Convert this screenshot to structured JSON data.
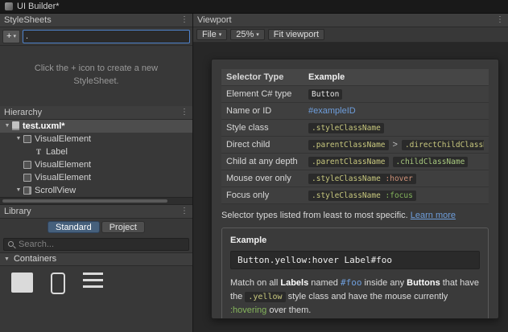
{
  "window": {
    "title": "UI Builder*"
  },
  "icons": {
    "kebab": "⋮",
    "dropdown": "▾",
    "fold_open": "▼"
  },
  "colors": {
    "plain": "#E6E6E6",
    "id": "#6E9EDC",
    "class": "#C8C87E",
    "class2": "#A8C97F",
    "hover": "#CE9178",
    "focus": "#85B55C",
    "sep": "#BFBFBF",
    "link": "#6E9EDC",
    "tab_active": "#46607C",
    "selection": "#4D4D4D",
    "focus_border": "#4F83CC"
  },
  "stylesheets": {
    "title": "StyleSheets",
    "add_label": "+",
    "selector_input_value": ".",
    "empty_message": "Click the + icon to create a new StyleSheet."
  },
  "hierarchy": {
    "title": "Hierarchy",
    "items": [
      {
        "label": "test.uxml*",
        "depth": 0,
        "arrow": "▼",
        "icon": "uxml-document",
        "selected": true
      },
      {
        "label": "VisualElement",
        "depth": 1,
        "arrow": "▼",
        "icon": "visual-element",
        "selected": false
      },
      {
        "label": "Label",
        "depth": 2,
        "arrow": "",
        "icon": "label",
        "selected": false
      },
      {
        "label": "VisualElement",
        "depth": 1,
        "arrow": "",
        "icon": "visual-element",
        "selected": false
      },
      {
        "label": "VisualElement",
        "depth": 1,
        "arrow": "",
        "icon": "visual-element",
        "selected": false
      },
      {
        "label": "ScrollView",
        "depth": 1,
        "arrow": "▼",
        "icon": "scroll-view",
        "selected": false
      }
    ]
  },
  "library": {
    "title": "Library",
    "tabs": [
      {
        "label": "Standard",
        "active": true
      },
      {
        "label": "Project",
        "active": false
      }
    ],
    "search_placeholder": "Search...",
    "containers_section": "Containers",
    "items": [
      {
        "name": "visual-element"
      },
      {
        "name": "scroll-view"
      },
      {
        "name": "list-view"
      }
    ]
  },
  "viewport": {
    "title": "Viewport",
    "toolbar": {
      "file_label": "File",
      "zoom_value": "25%",
      "fit_label": "Fit viewport"
    },
    "selector_table": {
      "headers": [
        "Selector Type",
        "Example"
      ],
      "rows": [
        {
          "label": "Element C# type",
          "example": [
            {
              "chip": true,
              "tokens": [
                {
                  "text": "Button",
                  "color": "plain"
                }
              ]
            }
          ]
        },
        {
          "label": "Name or ID",
          "example": [
            {
              "chip": false,
              "tokens": [
                {
                  "text": "#exampleID",
                  "color": "id"
                }
              ]
            }
          ]
        },
        {
          "label": "Style class",
          "example": [
            {
              "chip": true,
              "tokens": [
                {
                  "text": ".styleClassName",
                  "color": "class"
                }
              ]
            }
          ]
        },
        {
          "label": "Direct child",
          "example": [
            {
              "chip": true,
              "tokens": [
                {
                  "text": ".parentClassName",
                  "color": "class"
                }
              ]
            },
            {
              "chip": false,
              "tokens": [
                {
                  "text": ">",
                  "color": "sep"
                }
              ]
            },
            {
              "chip": true,
              "tokens": [
                {
                  "text": ".directChildClassName",
                  "color": "class"
                }
              ]
            }
          ]
        },
        {
          "label": "Child at any depth",
          "example": [
            {
              "chip": true,
              "tokens": [
                {
                  "text": ".parentClassName",
                  "color": "class"
                }
              ]
            },
            {
              "chip": true,
              "tokens": [
                {
                  "text": ".childClassName",
                  "color": "class2"
                }
              ]
            }
          ]
        },
        {
          "label": "Mouse over only",
          "example": [
            {
              "chip": true,
              "tokens": [
                {
                  "text": ".styleClassName",
                  "color": "class"
                },
                {
                  "text": " :hover",
                  "color": "hover"
                }
              ]
            }
          ]
        },
        {
          "label": "Focus only",
          "example": [
            {
              "chip": true,
              "tokens": [
                {
                  "text": ".styleClassName",
                  "color": "class"
                },
                {
                  "text": " :focus",
                  "color": "focus"
                }
              ]
            }
          ]
        }
      ]
    },
    "footer": {
      "text": "Selector types listed from least to most specific. ",
      "link": "Learn more"
    },
    "example_box": {
      "title": "Example",
      "code": "Button.yellow:hover Label#foo",
      "description": [
        {
          "text": "Match on all ",
          "style": "plain"
        },
        {
          "text": "Labels",
          "style": "bold"
        },
        {
          "text": " named ",
          "style": "plain"
        },
        {
          "text": "#foo",
          "style": "id"
        },
        {
          "text": " inside any ",
          "style": "plain"
        },
        {
          "text": "Buttons",
          "style": "bold"
        },
        {
          "text": " that have the ",
          "style": "plain"
        },
        {
          "text": ".yellow",
          "style": "class-chip"
        },
        {
          "text": " style class and have the mouse currently ",
          "style": "plain"
        },
        {
          "text": ":hovering",
          "style": "focus"
        },
        {
          "text": " over them.",
          "style": "plain"
        }
      ]
    }
  }
}
